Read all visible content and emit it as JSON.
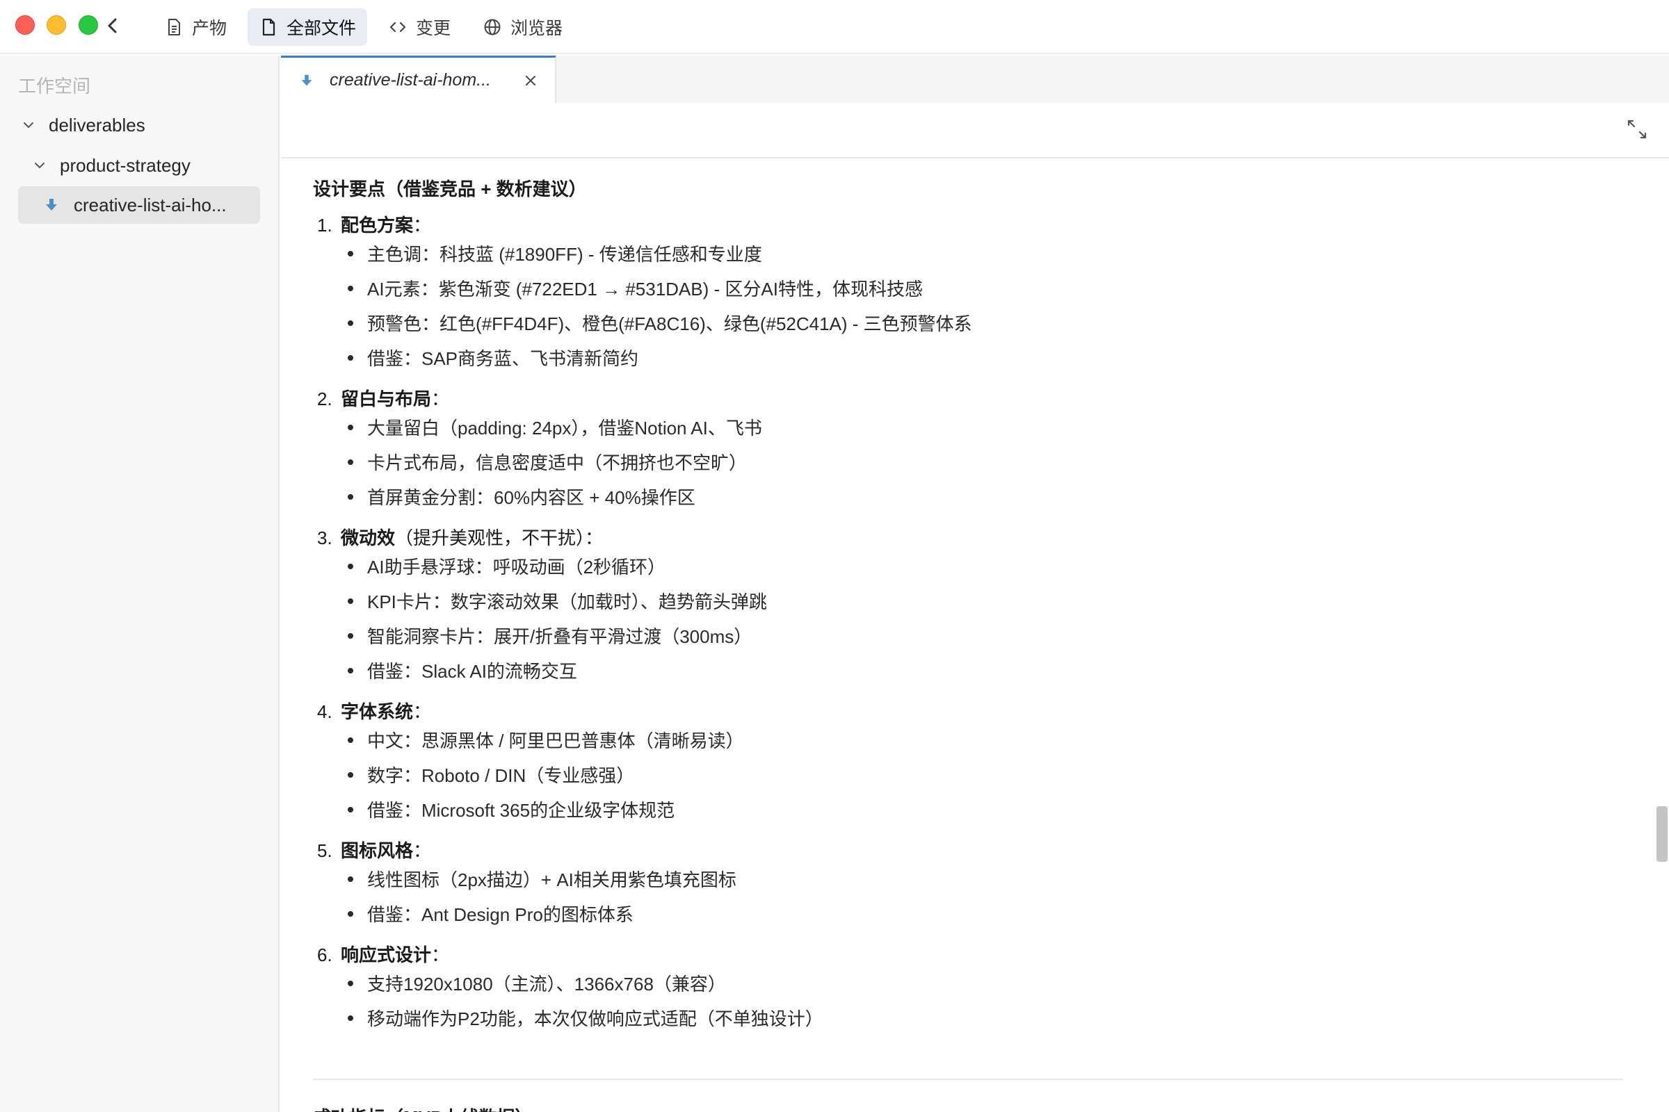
{
  "titlebar": {
    "tabs": [
      {
        "label": "产物",
        "icon": "document-icon",
        "active": false
      },
      {
        "label": "全部文件",
        "icon": "file-icon",
        "active": true
      },
      {
        "label": "变更",
        "icon": "code-icon",
        "active": false
      },
      {
        "label": "浏览器",
        "icon": "globe-icon",
        "active": false
      }
    ]
  },
  "sidebar": {
    "workspace_label": "工作空间",
    "tree": [
      {
        "label": "deliverables",
        "type": "folder",
        "expanded": true
      },
      {
        "label": "product-strategy",
        "type": "folder",
        "expanded": true
      },
      {
        "label": "creative-list-ai-ho...",
        "type": "file",
        "selected": true
      }
    ]
  },
  "editor": {
    "tab_title": "creative-list-ai-hom...",
    "heading": "设计要点（借鉴竞品 + 数析建议）",
    "sections": [
      {
        "num": "1.",
        "title": "配色方案",
        "rest": "：",
        "items": [
          "主色调：科技蓝 (#1890FF) - 传递信任感和专业度",
          "AI元素：紫色渐变 (#722ED1 → #531DAB) - 区分AI特性，体现科技感",
          "预警色：红色(#FF4D4F)、橙色(#FA8C16)、绿色(#52C41A) - 三色预警体系",
          "借鉴：SAP商务蓝、飞书清新简约"
        ]
      },
      {
        "num": "2.",
        "title": "留白与布局",
        "rest": "：",
        "items": [
          "大量留白（padding: 24px），借鉴Notion AI、飞书",
          "卡片式布局，信息密度适中（不拥挤也不空旷）",
          "首屏黄金分割：60%内容区 + 40%操作区"
        ]
      },
      {
        "num": "3.",
        "title": "微动效",
        "rest": "（提升美观性，不干扰）：",
        "items": [
          "AI助手悬浮球：呼吸动画（2秒循环）",
          "KPI卡片：数字滚动效果（加载时）、趋势箭头弹跳",
          "智能洞察卡片：展开/折叠有平滑过渡（300ms）",
          "借鉴：Slack AI的流畅交互"
        ]
      },
      {
        "num": "4.",
        "title": "字体系统",
        "rest": "：",
        "items": [
          "中文：思源黑体 / 阿里巴巴普惠体（清晰易读）",
          "数字：Roboto / DIN（专业感强）",
          "借鉴：Microsoft 365的企业级字体规范"
        ]
      },
      {
        "num": "5.",
        "title": "图标风格",
        "rest": "：",
        "items": [
          "线性图标（2px描边）+ AI相关用紫色填充图标",
          "借鉴：Ant Design Pro的图标体系"
        ]
      },
      {
        "num": "6.",
        "title": "响应式设计",
        "rest": "：",
        "items": [
          "支持1920x1080（主流）、1366x768（兼容）",
          "移动端作为P2功能，本次仅做响应式适配（不单独设计）"
        ]
      }
    ],
    "cutoff_text": "成功指标（MVP上线数据）"
  },
  "colors": {
    "file_icon": "#4a90c8",
    "active_tab_border": "#3b78d8",
    "traffic_red": "#ff5f57",
    "traffic_yellow": "#febc2e",
    "traffic_green": "#28c840"
  }
}
